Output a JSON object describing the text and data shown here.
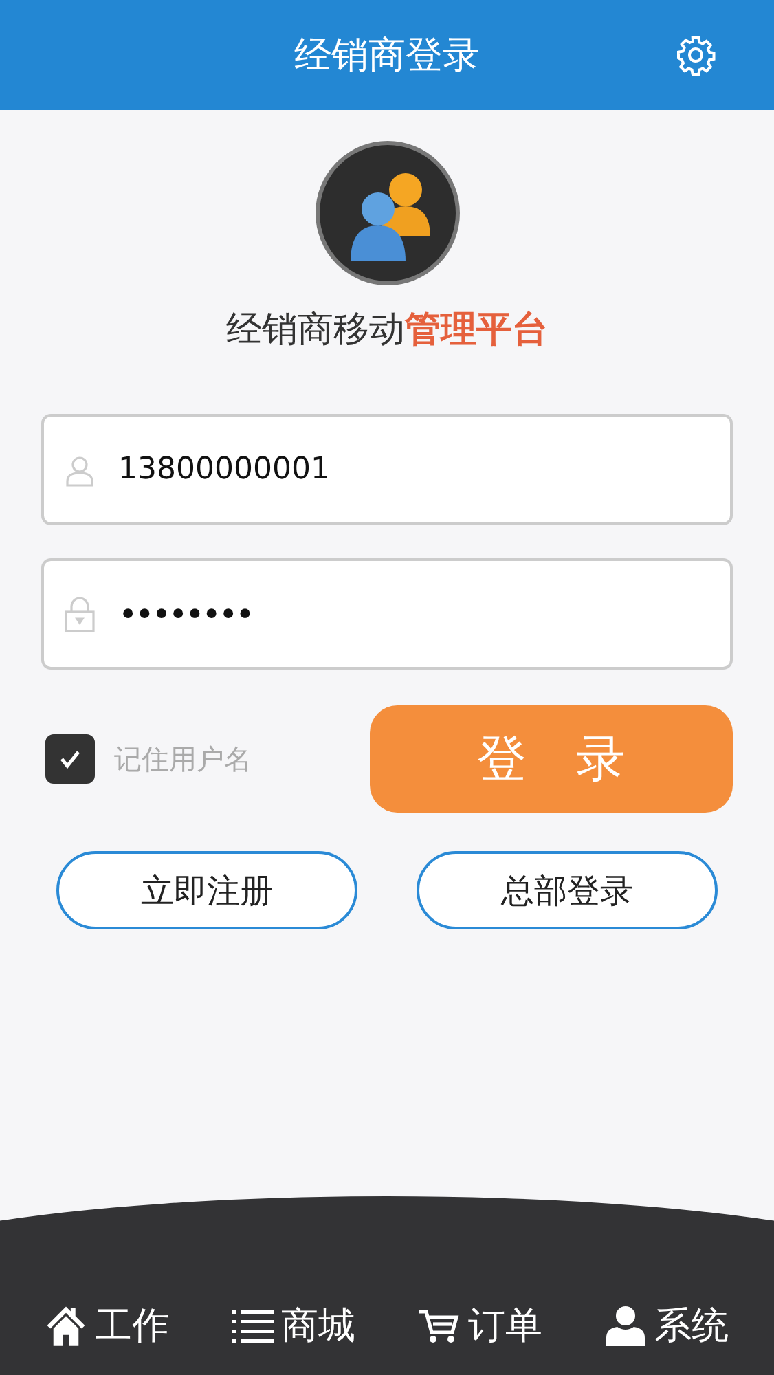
{
  "header": {
    "title": "经销商登录"
  },
  "brand": {
    "title_plain": "经销商移动",
    "title_highlight": "管理平台"
  },
  "form": {
    "username": {
      "value": "13800000001"
    },
    "password": {
      "value": "••••••••"
    },
    "remember": {
      "label": "记住用户名",
      "checked": true
    },
    "login_button": "登　录",
    "buttons": [
      "立即注册",
      "总部登录"
    ]
  },
  "nav": [
    {
      "kind": "home",
      "label": "工作"
    },
    {
      "kind": "list",
      "label": "商城"
    },
    {
      "kind": "cart",
      "label": "订单"
    },
    {
      "kind": "user",
      "label": "系统"
    }
  ]
}
